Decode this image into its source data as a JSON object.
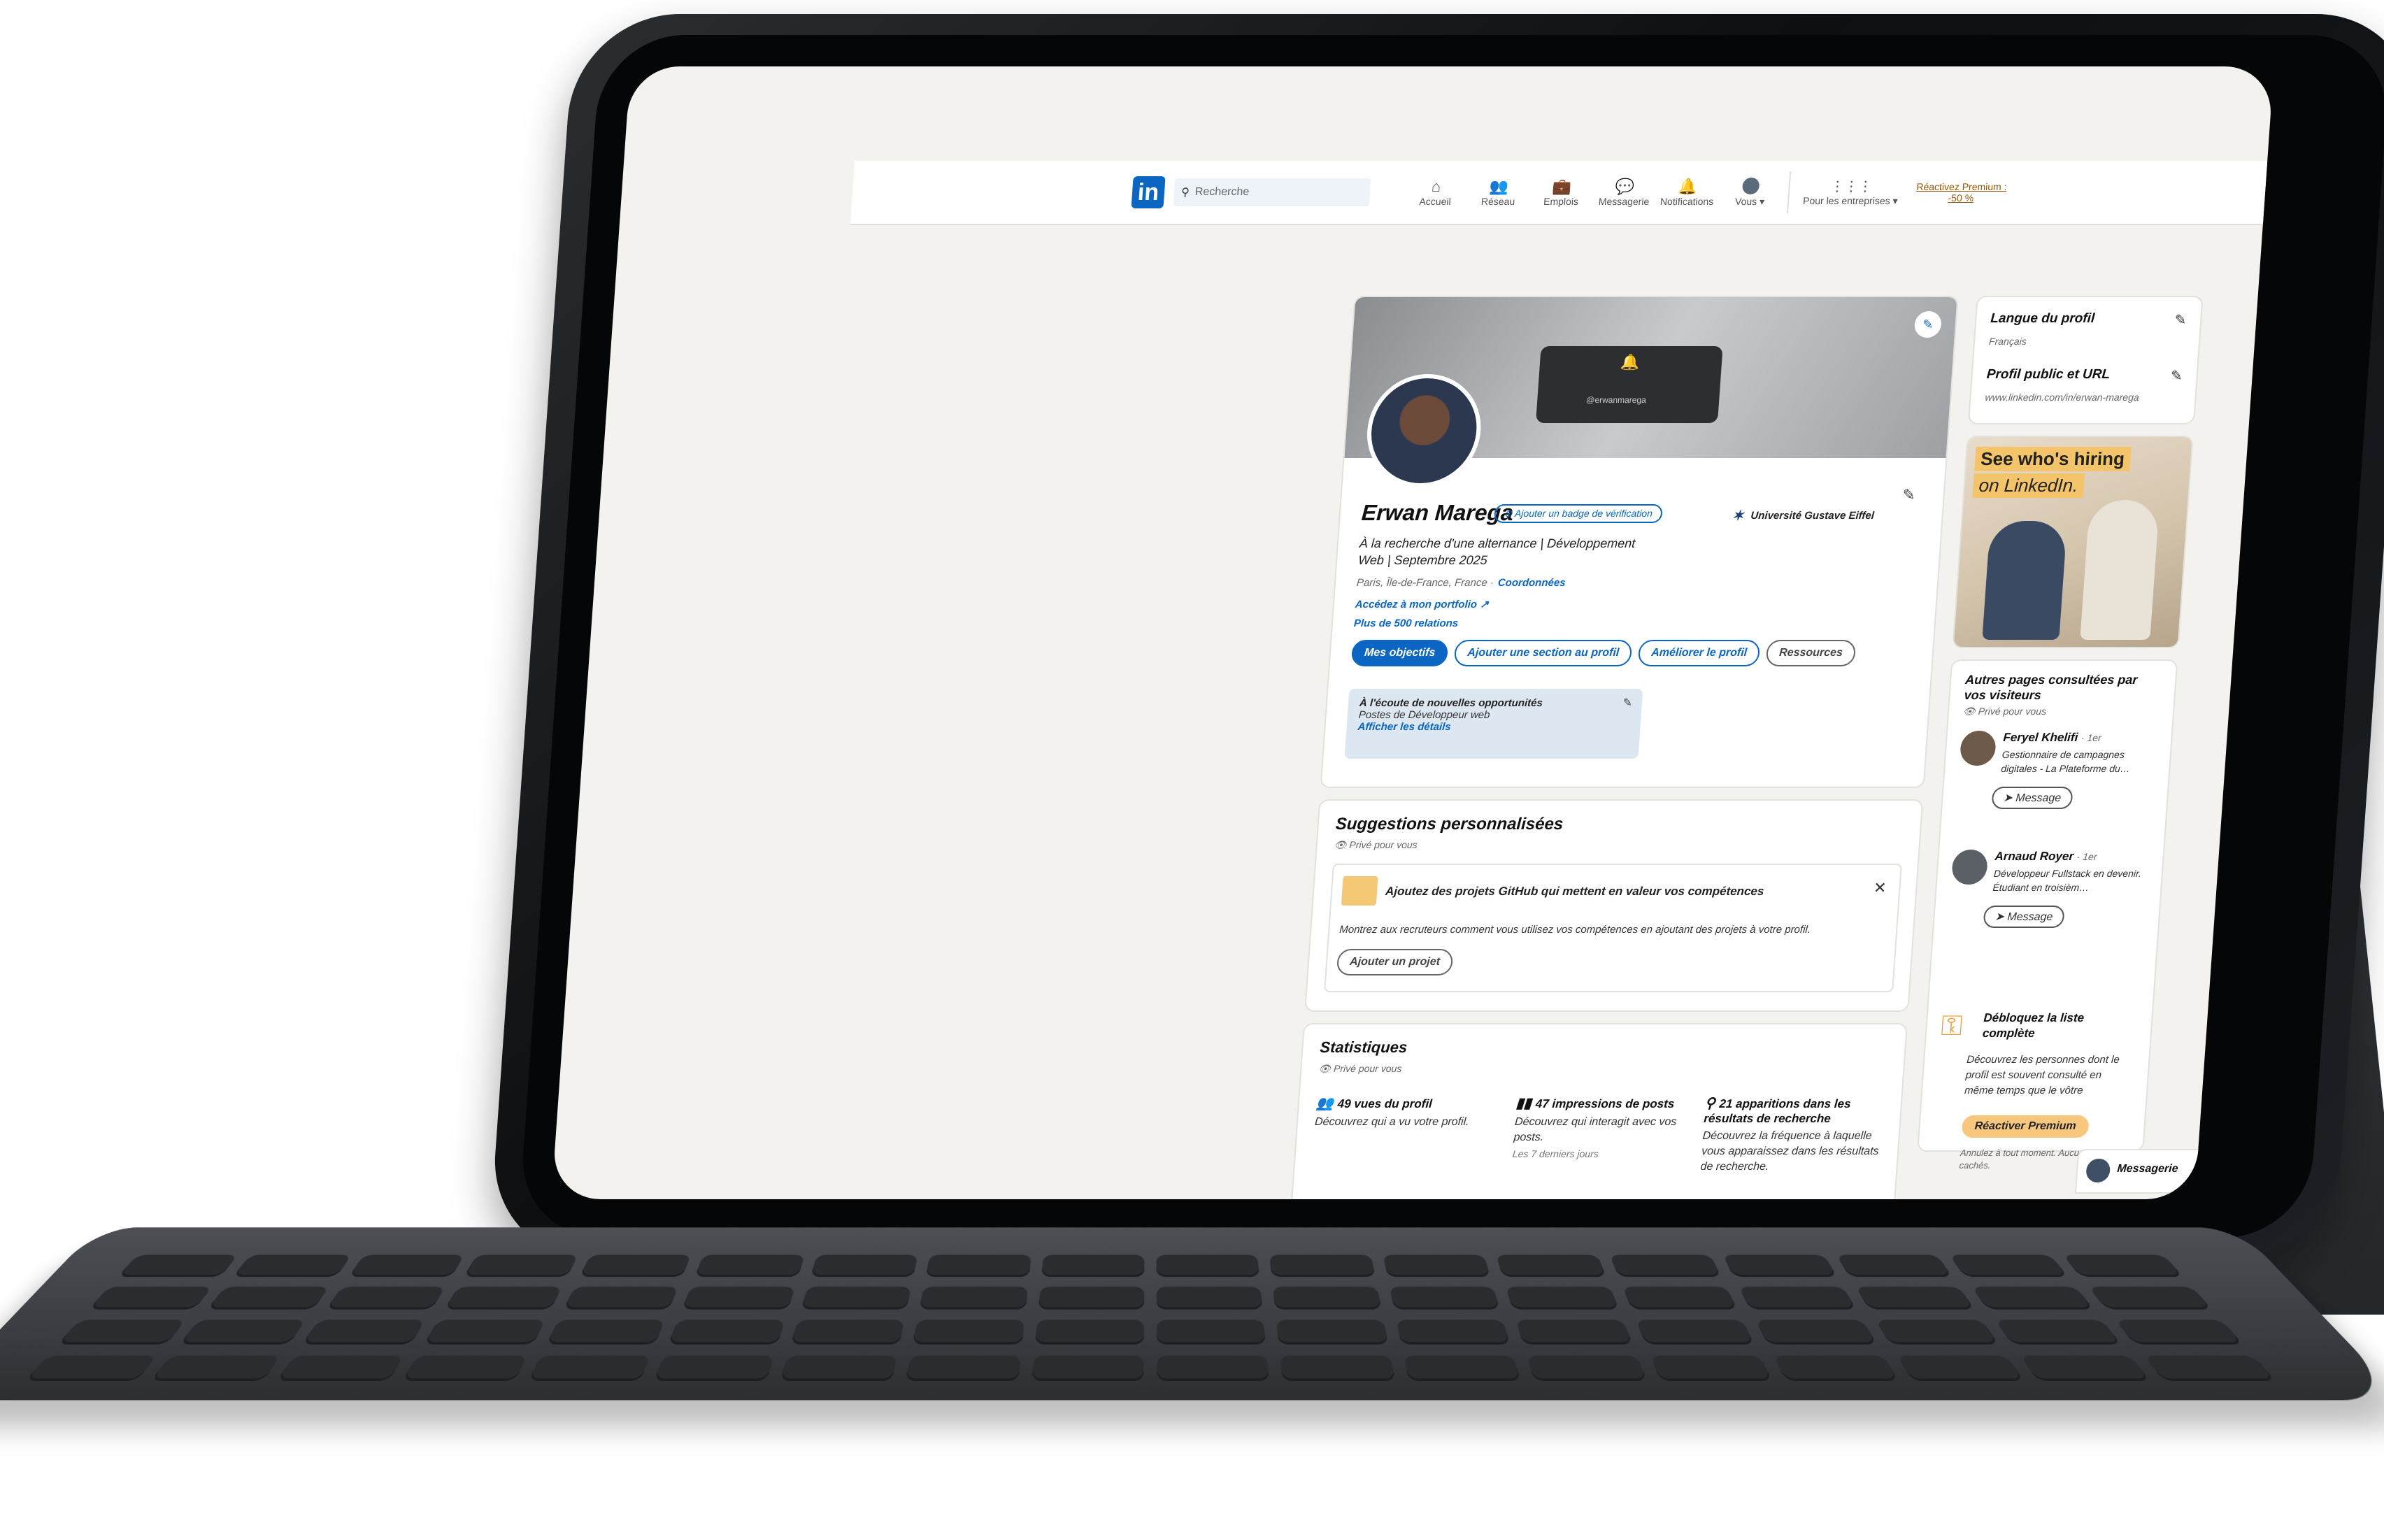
{
  "topbar": {
    "logo": "in",
    "search_placeholder": "Recherche",
    "nav": [
      {
        "label": "Accueil",
        "icon": "home-icon",
        "glyph": "⌂"
      },
      {
        "label": "Réseau",
        "icon": "network-icon",
        "glyph": "👥"
      },
      {
        "label": "Emplois",
        "icon": "briefcase-icon",
        "glyph": "💼"
      },
      {
        "label": "Messagerie",
        "icon": "message-icon",
        "glyph": "💬"
      },
      {
        "label": "Notifications",
        "icon": "bell-icon",
        "glyph": "🔔"
      },
      {
        "label": "Vous ▾",
        "icon": "avatar-icon",
        "glyph": ""
      }
    ],
    "business": "Pour les entreprises ▾",
    "premium": "Réactivez Premium : -50 %"
  },
  "profile": {
    "banner_handle": "@erwanmarega",
    "name": "Erwan Marega",
    "verification_badge": "Ajouter un badge de vérification",
    "headline": "À la recherche d'une alternance | Développement Web | Septembre 2025",
    "location": "Paris, Île-de-France, France ·",
    "contact_link": "Coordonnées",
    "portfolio": "Accédez à mon portfolio",
    "relations": "Plus de 500 relations",
    "school": "Université Gustave Eiffel",
    "buttons": {
      "objectives": "Mes objectifs",
      "add_section": "Ajouter une section au profil",
      "improve": "Améliorer le profil",
      "resources": "Ressources"
    },
    "open_to_work": {
      "title": "À l'écoute de nouvelles opportunités",
      "roles": "Postes de Développeur web",
      "details": "Afficher les détails"
    }
  },
  "suggestions": {
    "title": "Suggestions personnalisées",
    "private": "Privé pour vous",
    "card_title": "Ajoutez des projets GitHub qui mettent en valeur vos compétences",
    "card_desc": "Montrez aux recruteurs comment vous utilisez vos compétences en ajoutant des projets à votre profil.",
    "card_button": "Ajouter un projet"
  },
  "stats": {
    "title": "Statistiques",
    "private": "Privé pour vous",
    "items": [
      {
        "value": "49 vues du profil",
        "desc": "Découvrez qui a vu votre profil.",
        "note": ""
      },
      {
        "value": "47 impressions de posts",
        "desc": "Découvrez qui interagit avec vos posts.",
        "note": "Les 7 derniers jours"
      },
      {
        "value": "21 apparitions dans les résultats de recherche",
        "desc": "Découvrez la fréquence à laquelle vous apparaissez dans les résultats de recherche.",
        "note": ""
      }
    ]
  },
  "sidebar": {
    "lang_title": "Langue du profil",
    "lang_value": "Français",
    "url_title": "Profil public et URL",
    "url_value": "www.linkedin.com/in/erwan-marega",
    "ad_line1": "See who's hiring",
    "ad_line2": "on LinkedIn.",
    "visitors_title": "Autres pages consultées par vos visiteurs",
    "visitors_private": "Privé pour vous",
    "people": [
      {
        "name": "Feryel Khelifi",
        "degree": "· 1er",
        "desc": "Gestionnaire de campagnes digitales - La Plateforme du…",
        "button": "Message"
      },
      {
        "name": "Arnaud Royer",
        "degree": "· 1er",
        "desc": "Développeur Fullstack en devenir. Étudiant en troisièm…",
        "button": "Message"
      }
    ],
    "unlock_title": "Débloquez la liste complète",
    "unlock_desc": "Découvrez les personnes dont le profil est souvent consulté en même temps que le vôtre",
    "unlock_button": "Réactiver Premium",
    "unlock_note": "Annulez à tout moment. Aucuns frais cachés."
  },
  "messaging": {
    "title": "Messagerie"
  }
}
